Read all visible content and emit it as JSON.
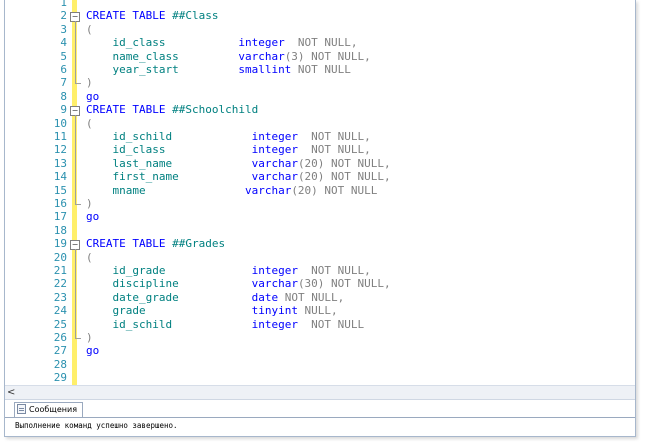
{
  "code_lines": [
    {
      "n": "1",
      "segs": []
    },
    {
      "n": "2",
      "segs": [
        {
          "t": "CREATE TABLE ",
          "c": "kw"
        },
        {
          "t": "##Class",
          "c": "id"
        }
      ]
    },
    {
      "n": "3",
      "segs": [
        {
          "t": "(",
          "c": "gr"
        }
      ]
    },
    {
      "n": "4",
      "segs": [
        {
          "t": "    id_class           ",
          "c": "id"
        },
        {
          "t": "integer",
          "c": "ty"
        },
        {
          "t": "  NOT NULL,",
          "c": "gr"
        }
      ]
    },
    {
      "n": "5",
      "segs": [
        {
          "t": "    name_class         ",
          "c": "id"
        },
        {
          "t": "varchar",
          "c": "ty"
        },
        {
          "t": "(3) NOT NULL,",
          "c": "gr"
        }
      ]
    },
    {
      "n": "6",
      "segs": [
        {
          "t": "    year_start         ",
          "c": "id"
        },
        {
          "t": "smallint",
          "c": "ty"
        },
        {
          "t": " NOT NULL",
          "c": "gr"
        }
      ]
    },
    {
      "n": "7",
      "segs": [
        {
          "t": ")",
          "c": "gr"
        }
      ]
    },
    {
      "n": "8",
      "segs": [
        {
          "t": "go",
          "c": "kw"
        }
      ]
    },
    {
      "n": "9",
      "segs": [
        {
          "t": "CREATE TABLE ",
          "c": "kw"
        },
        {
          "t": "##Schoolchild",
          "c": "id"
        }
      ]
    },
    {
      "n": "10",
      "segs": [
        {
          "t": "(",
          "c": "gr"
        }
      ]
    },
    {
      "n": "11",
      "segs": [
        {
          "t": "    id_schild            ",
          "c": "id"
        },
        {
          "t": "integer",
          "c": "ty"
        },
        {
          "t": "  NOT NULL,",
          "c": "gr"
        }
      ]
    },
    {
      "n": "12",
      "segs": [
        {
          "t": "    id_class             ",
          "c": "id"
        },
        {
          "t": "integer",
          "c": "ty"
        },
        {
          "t": "  NOT NULL,",
          "c": "gr"
        }
      ]
    },
    {
      "n": "13",
      "segs": [
        {
          "t": "    last_name            ",
          "c": "id"
        },
        {
          "t": "varchar",
          "c": "ty"
        },
        {
          "t": "(20) NOT NULL,",
          "c": "gr"
        }
      ]
    },
    {
      "n": "14",
      "segs": [
        {
          "t": "    first_name           ",
          "c": "id"
        },
        {
          "t": "varchar",
          "c": "ty"
        },
        {
          "t": "(20) NOT NULL,",
          "c": "gr"
        }
      ]
    },
    {
      "n": "15",
      "segs": [
        {
          "t": "    mname               ",
          "c": "id"
        },
        {
          "t": "varchar",
          "c": "ty"
        },
        {
          "t": "(20) NOT NULL",
          "c": "gr"
        }
      ]
    },
    {
      "n": "16",
      "segs": [
        {
          "t": ")",
          "c": "gr"
        }
      ]
    },
    {
      "n": "17",
      "segs": [
        {
          "t": "go",
          "c": "kw"
        }
      ]
    },
    {
      "n": "18",
      "segs": []
    },
    {
      "n": "19",
      "segs": [
        {
          "t": "CREATE TABLE ",
          "c": "kw"
        },
        {
          "t": "##Grades",
          "c": "id"
        }
      ]
    },
    {
      "n": "20",
      "segs": [
        {
          "t": "(",
          "c": "gr"
        }
      ]
    },
    {
      "n": "21",
      "segs": [
        {
          "t": "    id_grade             ",
          "c": "id"
        },
        {
          "t": "integer",
          "c": "ty"
        },
        {
          "t": "  NOT NULL,",
          "c": "gr"
        }
      ]
    },
    {
      "n": "22",
      "segs": [
        {
          "t": "    discipline           ",
          "c": "id"
        },
        {
          "t": "varchar",
          "c": "ty"
        },
        {
          "t": "(30) NOT NULL,",
          "c": "gr"
        }
      ]
    },
    {
      "n": "23",
      "segs": [
        {
          "t": "    date_grade           ",
          "c": "id"
        },
        {
          "t": "date",
          "c": "ty"
        },
        {
          "t": " NOT NULL,",
          "c": "gr"
        }
      ]
    },
    {
      "n": "24",
      "segs": [
        {
          "t": "    grade                ",
          "c": "id"
        },
        {
          "t": "tinyint",
          "c": "ty"
        },
        {
          "t": " NULL,",
          "c": "gr"
        }
      ]
    },
    {
      "n": "25",
      "segs": [
        {
          "t": "    id_schild            ",
          "c": "id"
        },
        {
          "t": "integer",
          "c": "ty"
        },
        {
          "t": "  NOT NULL",
          "c": "gr"
        }
      ]
    },
    {
      "n": "26",
      "segs": [
        {
          "t": ")",
          "c": "gr"
        }
      ]
    },
    {
      "n": "27",
      "segs": [
        {
          "t": "go",
          "c": "kw"
        }
      ]
    },
    {
      "n": "28",
      "segs": []
    },
    {
      "n": "29",
      "segs": []
    }
  ],
  "fold_markers": [
    "2",
    "9",
    "19"
  ],
  "colors": {
    "keyword": "#0000ff",
    "identifier": "#008080",
    "gray": "#808080",
    "line_number": "#2b91af",
    "change_bar": "#ffef6a"
  },
  "messages_panel": {
    "tab_label": "Сообщения",
    "tab_icon": "messages-icon",
    "text": "Выполнение команд успешно завершено."
  },
  "scrollbar": {
    "left_arrow": "<"
  }
}
